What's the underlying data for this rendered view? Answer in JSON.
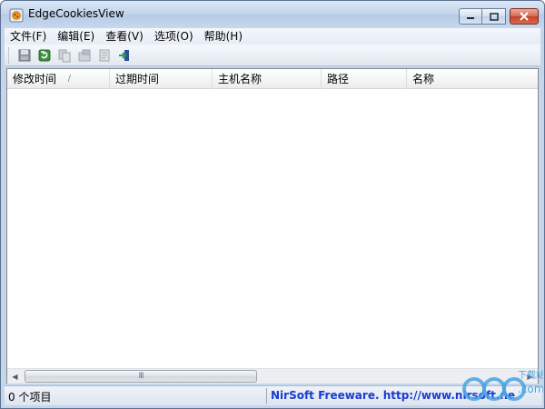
{
  "window": {
    "title": "EdgeCookiesView"
  },
  "menubar": {
    "items": [
      "文件(F)",
      "编辑(E)",
      "查看(V)",
      "选项(O)",
      "帮助(H)"
    ]
  },
  "toolbar": {
    "buttons": [
      "save-icon",
      "refresh-icon",
      "copy-icon",
      "properties-icon",
      "report-icon",
      "exit-icon"
    ]
  },
  "list": {
    "columns": [
      "修改时间",
      "过期时间",
      "主机名称",
      "路径",
      "名称"
    ],
    "sort_indicator": "/",
    "rows": []
  },
  "scrollbar": {
    "grip": "III"
  },
  "statusbar": {
    "item_count": "0 个项目",
    "credit": "NirSoft Freeware.  http://www.nirsoft.ne"
  },
  "watermark": {
    "text": "pc6",
    "sub": "下载站",
    "domain": ".com"
  },
  "colors": {
    "frame": "#c6d6ea",
    "close_button": "#c3422a",
    "link": "#1a3bd1",
    "watermark": "#4aa3df"
  }
}
